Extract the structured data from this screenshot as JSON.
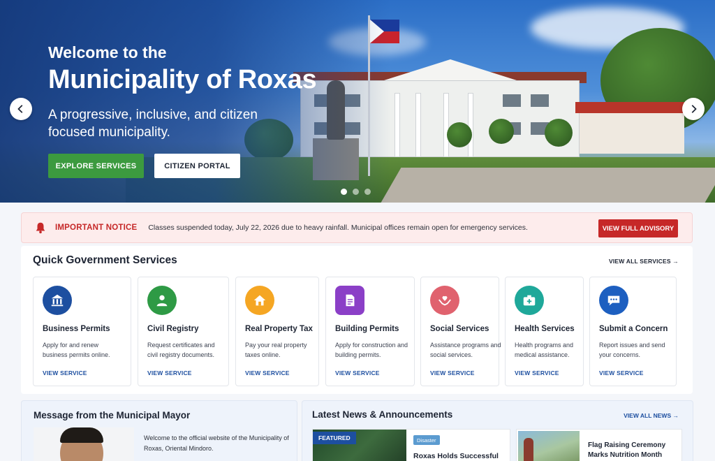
{
  "hero": {
    "kicker": "Welcome to the",
    "title": "Municipality of Roxas",
    "subtitle": "A progressive, inclusive, and citizen focused municipality.",
    "explore_label": "EXPLORE SERVICES",
    "portal_label": "CITIZEN PORTAL",
    "slide_count": 3,
    "active_slide": 1
  },
  "notice": {
    "label": "IMPORTANT NOTICE",
    "message": "Classes suspended today, July 22, 2026 due to heavy rainfall. Municipal offices remain open for emergency services.",
    "button": "VIEW FULL ADVISORY"
  },
  "services": {
    "heading": "Quick Government Services",
    "view_all": "VIEW ALL SERVICES →",
    "items": [
      {
        "name": "Business Permits",
        "desc": "Apply for and renew business permits online.",
        "link": "VIEW SERVICE",
        "icon": "building-icon",
        "color": "#1d4fa0"
      },
      {
        "name": "Civil Registry",
        "desc": "Request certificates and civil registry documents.",
        "link": "VIEW SERVICE",
        "icon": "person-icon",
        "color": "#2e9a45"
      },
      {
        "name": "Real Property Tax",
        "desc": "Pay your real property taxes online.",
        "link": "VIEW SERVICE",
        "icon": "home-icon",
        "color": "#f5a623"
      },
      {
        "name": "Building Permits",
        "desc": "Apply for construction and building permits.",
        "link": "VIEW SERVICE",
        "icon": "document-icon",
        "color": "#8b3fc7"
      },
      {
        "name": "Social Services",
        "desc": "Assistance programs and social services.",
        "link": "VIEW SERVICE",
        "icon": "heart-hands-icon",
        "color": "#e0626e"
      },
      {
        "name": "Health Services",
        "desc": "Health programs and medical assistance.",
        "link": "VIEW SERVICE",
        "icon": "medical-kit-icon",
        "color": "#1fa89a"
      },
      {
        "name": "Submit a Concern",
        "desc": "Report issues and send your concerns.",
        "link": "VIEW SERVICE",
        "icon": "chat-icon",
        "color": "#1d5fc0"
      }
    ]
  },
  "mayor": {
    "heading": "Message from the Municipal Mayor",
    "message": "Welcome to the official website of the Municipality of Roxas, Oriental Mindoro."
  },
  "news": {
    "heading": "Latest News & Announcements",
    "view_all": "VIEW ALL NEWS →",
    "featured_badge": "FEATURED",
    "featured_category": "Disaster",
    "featured_title": "Roxas Holds Successful",
    "second_title": "Flag Raising Ceremony Marks Nutrition Month"
  }
}
